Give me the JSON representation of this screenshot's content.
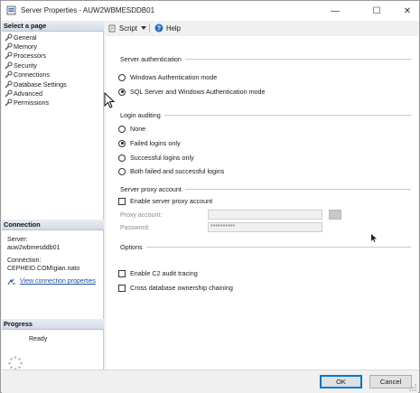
{
  "window": {
    "title": "Server Properties - AUW2WBMESDDB01",
    "min_glyph": "—",
    "max_glyph": "☐",
    "close_glyph": "✕"
  },
  "left": {
    "select_page_header": "Select a page",
    "pages": [
      {
        "label": "General"
      },
      {
        "label": "Memory"
      },
      {
        "label": "Processors"
      },
      {
        "label": "Security"
      },
      {
        "label": "Connections"
      },
      {
        "label": "Database Settings"
      },
      {
        "label": "Advanced"
      },
      {
        "label": "Permissions"
      }
    ],
    "connection_header": "Connection",
    "server_label": "Server:",
    "server_value": "auw2wbmesddb01",
    "connection_label": "Connection:",
    "connection_value": "CEPHEID.COM\\gian.nato",
    "view_props_link": "View connection properties",
    "progress_header": "Progress",
    "progress_status": "Ready"
  },
  "toolbar": {
    "script_label": "Script",
    "help_label": "Help"
  },
  "main": {
    "server_auth": {
      "title": "Server authentication",
      "options": [
        {
          "label": "Windows Authentication mode",
          "selected": false
        },
        {
          "label": "SQL Server and Windows Authentication mode",
          "selected": true
        }
      ]
    },
    "login_auditing": {
      "title": "Login auditing",
      "options": [
        {
          "label": "None",
          "selected": false
        },
        {
          "label": "Failed logins only",
          "selected": true
        },
        {
          "label": "Successful logins only",
          "selected": false
        },
        {
          "label": "Both failed and successful logins",
          "selected": false
        }
      ]
    },
    "proxy": {
      "title": "Server proxy account",
      "enable_label": "Enable server proxy account",
      "enabled": false,
      "proxy_account_label": "Proxy account:",
      "proxy_account_value": "",
      "password_label": "Password:",
      "password_value": "**********"
    },
    "options": {
      "title": "Options",
      "c2_label": "Enable C2 audit tracing",
      "c2_checked": false,
      "cross_db_label": "Cross database ownership chaining",
      "cross_db_checked": false
    }
  },
  "buttons": {
    "ok": "OK",
    "cancel": "Cancel"
  },
  "colors": {
    "accent": "#0078d7",
    "link": "#1a4fb3",
    "header_bg": "#d3dbe6"
  }
}
